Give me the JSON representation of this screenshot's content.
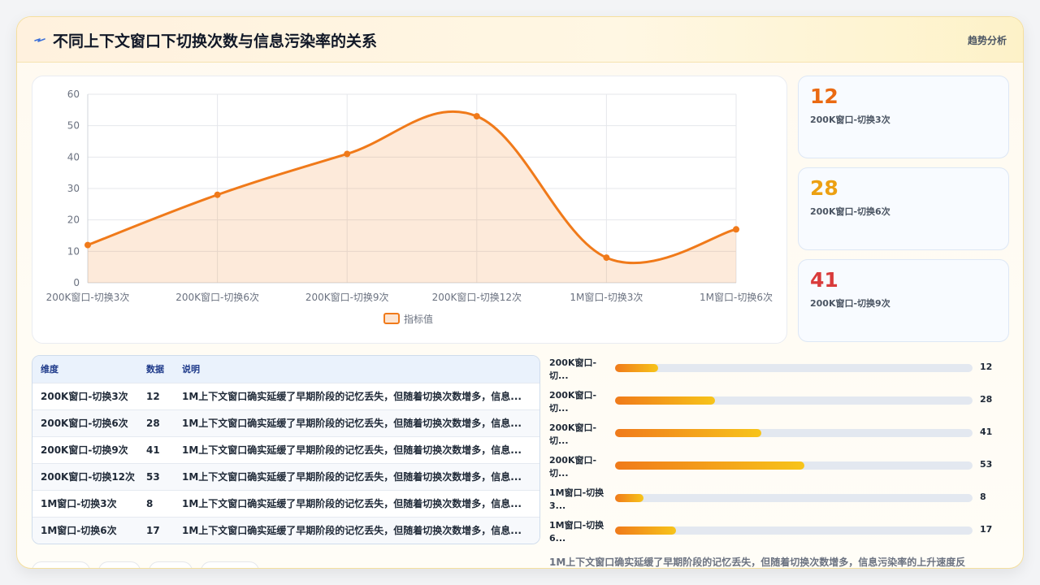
{
  "header": {
    "title": "不同上下文窗口下切换次数与信息污染率的关系",
    "action": "趋势分析",
    "icon": "lightning-icon"
  },
  "chart_data": {
    "type": "area",
    "categories": [
      "200K窗口-切换3次",
      "200K窗口-切换6次",
      "200K窗口-切换9次",
      "200K窗口-切换12次",
      "1M窗口-切换3次",
      "1M窗口-切换6次"
    ],
    "series": [
      {
        "name": "指标值",
        "values": [
          12,
          28,
          41,
          53,
          8,
          17
        ],
        "color": "#f07a1a"
      }
    ],
    "ylim": [
      0,
      60
    ],
    "yticks": [
      0,
      10,
      20,
      30,
      40,
      50,
      60
    ],
    "grid": true,
    "legend": "bottom",
    "smooth": true
  },
  "stats": [
    {
      "value": "12",
      "label": "200K窗口-切换3次",
      "color": "#ea6a12"
    },
    {
      "value": "28",
      "label": "200K窗口-切换6次",
      "color": "#eca012"
    },
    {
      "value": "41",
      "label": "200K窗口-切换9次",
      "color": "#d93b3b"
    }
  ],
  "table": {
    "headers": [
      "维度",
      "数据",
      "说明"
    ],
    "rows": [
      [
        "200K窗口-切换3次",
        "12",
        "1M上下文窗口确实延缓了早期阶段的记忆丢失，但随着切换次数增多，信息..."
      ],
      [
        "200K窗口-切换6次",
        "28",
        "1M上下文窗口确实延缓了早期阶段的记忆丢失，但随着切换次数增多，信息..."
      ],
      [
        "200K窗口-切换9次",
        "41",
        "1M上下文窗口确实延缓了早期阶段的记忆丢失，但随着切换次数增多，信息..."
      ],
      [
        "200K窗口-切换12次",
        "53",
        "1M上下文窗口确实延缓了早期阶段的记忆丢失，但随着切换次数增多，信息..."
      ],
      [
        "1M窗口-切换3次",
        "8",
        "1M上下文窗口确实延缓了早期阶段的记忆丢失，但随着切换次数增多，信息..."
      ],
      [
        "1M窗口-切换6次",
        "17",
        "1M上下文窗口确实延缓了早期阶段的记忆丢失，但随着切换次数增多，信息..."
      ]
    ]
  },
  "bars": {
    "max": 100,
    "items": [
      {
        "label_line1": "200K窗口-",
        "label_line2": "切...",
        "value": "12",
        "fraction": 0.12
      },
      {
        "label_line1": "200K窗口-",
        "label_line2": "切...",
        "value": "28",
        "fraction": 0.28
      },
      {
        "label_line1": "200K窗口-",
        "label_line2": "切...",
        "value": "41",
        "fraction": 0.41
      },
      {
        "label_line1": "200K窗口-",
        "label_line2": "切...",
        "value": "53",
        "fraction": 0.53
      },
      {
        "label_line1": "1M窗口-切换",
        "label_line2": "3...",
        "value": "8",
        "fraction": 0.08
      },
      {
        "label_line1": "1M窗口-切换",
        "label_line2": "6...",
        "value": "17",
        "fraction": 0.17
      }
    ]
  },
  "summary": "1M上下文窗口确实延缓了早期阶段的记忆丢失，但随着切换次数增多，信息污染率的上升速度反"
}
